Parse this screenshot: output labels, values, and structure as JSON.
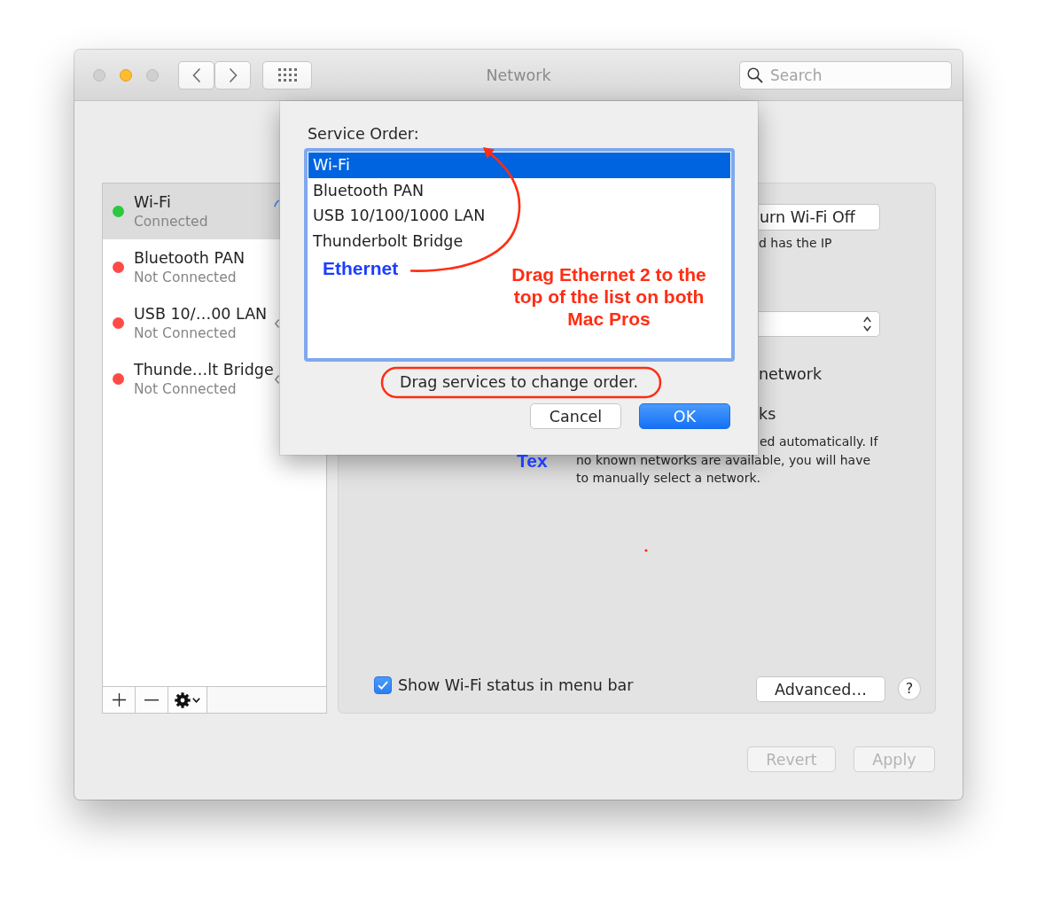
{
  "window": {
    "title": "Network",
    "controls": [
      {
        "kind": "close",
        "disabled": true
      },
      {
        "kind": "minimize",
        "disabled": false
      },
      {
        "kind": "zoom",
        "disabled": true
      }
    ],
    "search": {
      "placeholder": "Search"
    }
  },
  "services": [
    {
      "kind": "wifi",
      "name": "Wi-Fi",
      "status": "Connected",
      "color": "#2bc840",
      "selected": true
    },
    {
      "kind": "bluetooth",
      "name": "Bluetooth PAN",
      "status": "Not Connected",
      "color": "#fc4b47",
      "selected": false
    },
    {
      "kind": "ethernet",
      "name": "USB 10/…00 LAN",
      "status": "Not Connected",
      "color": "#fc4b47",
      "selected": false
    },
    {
      "kind": "ethernet",
      "name": "Thunde…lt Bridge",
      "status": "Not Connected",
      "color": "#fc4b47",
      "selected": false
    }
  ],
  "detail": {
    "power_button": "urn Wi-Fi Off",
    "status_fragment": "d has the IP",
    "ask_fragment": "network",
    "known_fragment": "ks",
    "description_fragment": "ed automatically. If",
    "description": "no known networks are available, you will have to manually select a network.",
    "show_status": {
      "label": "Show Wi-Fi status in menu bar",
      "checked": true
    },
    "advanced_button": "Advanced…",
    "help_button": "?"
  },
  "footer_buttons": [
    {
      "kind": "revert",
      "label": "Revert",
      "disabled": true
    },
    {
      "kind": "apply",
      "label": "Apply",
      "disabled": true
    }
  ],
  "sheet": {
    "title": "Service Order:",
    "services": [
      {
        "name": "Wi-Fi",
        "selected": true
      },
      {
        "name": "Bluetooth PAN",
        "selected": false
      },
      {
        "name": "USB 10/100/1000 LAN",
        "selected": false
      },
      {
        "name": "Thunderbolt Bridge",
        "selected": false
      }
    ],
    "hint": "Drag services to change order.",
    "buttons": [
      {
        "kind": "secondary",
        "label": "Cancel"
      },
      {
        "kind": "default",
        "label": "OK"
      }
    ]
  },
  "annotations": [
    {
      "kind": "label",
      "text": "Ethernet"
    },
    {
      "kind": "note",
      "text": "Drag Ethernet 2 to the top of the list on both Mac Pros"
    },
    {
      "kind": "label",
      "text": "Tex"
    }
  ]
}
